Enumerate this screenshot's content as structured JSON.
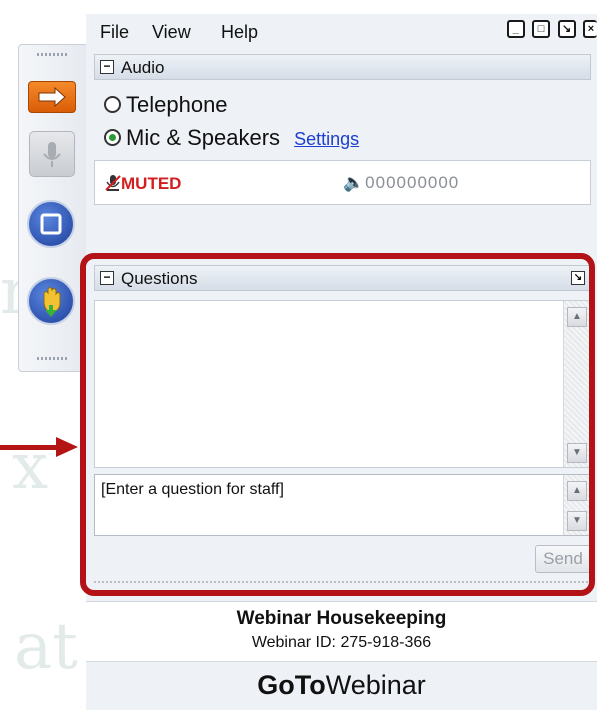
{
  "menu": {
    "file": "File",
    "view": "View",
    "help": "Help"
  },
  "window_controls": [
    "minimize-icon",
    "restore-icon",
    "popout-icon",
    "close-icon"
  ],
  "audio": {
    "title": "Audio",
    "options": [
      {
        "label": "Telephone",
        "selected": false
      },
      {
        "label": "Mic & Speakers",
        "selected": true
      }
    ],
    "settings_link": "Settings",
    "status": "MUTED",
    "level_indicator": "000000000"
  },
  "questions": {
    "title": "Questions",
    "placeholder": "[Enter a question for staff]",
    "send_label": "Send"
  },
  "footer": {
    "title": "Webinar Housekeeping",
    "webinar_id": "Webinar ID: 275-918-366",
    "brand_bold": "GoTo",
    "brand_rest": "Webinar"
  },
  "colors": {
    "highlight": "#b31217",
    "accent": "#f58a2a",
    "muted": "#d31f1f",
    "link": "#1a3fcf"
  }
}
